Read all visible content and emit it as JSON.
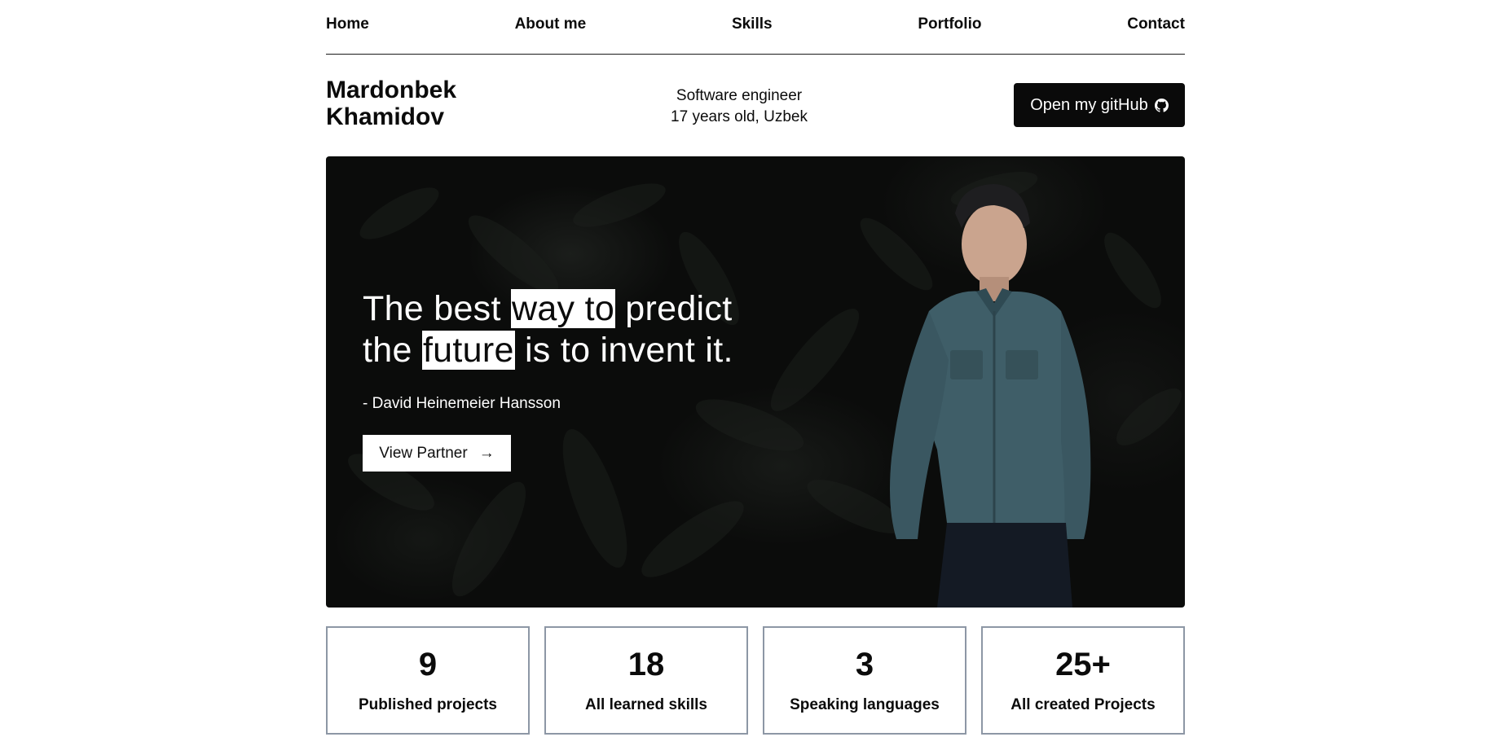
{
  "nav": {
    "items": [
      {
        "label": "Home"
      },
      {
        "label": "About me"
      },
      {
        "label": "Skills"
      },
      {
        "label": "Portfolio"
      },
      {
        "label": "Contact"
      }
    ]
  },
  "header": {
    "name_line1": "Mardonbek",
    "name_line2": "Khamidov",
    "role": "Software engineer",
    "age_nationality": "17 years old, Uzbek",
    "github_button": "Open my gitHub",
    "github_icon": "github-icon"
  },
  "hero": {
    "quote_part1": "The best ",
    "quote_hl1": "way to",
    "quote_part2": " predict",
    "quote_part3": "the ",
    "quote_hl2": "future",
    "quote_part4": " is to invent it.",
    "author": "- David Heinemeier Hansson",
    "cta_label": "View Partner",
    "cta_icon": "arrow-right-icon"
  },
  "stats": [
    {
      "number": "9",
      "label": "Published projects"
    },
    {
      "number": "18",
      "label": "All learned skills"
    },
    {
      "number": "3",
      "label": "Speaking languages"
    },
    {
      "number": "25+",
      "label": "All created Projects"
    }
  ]
}
